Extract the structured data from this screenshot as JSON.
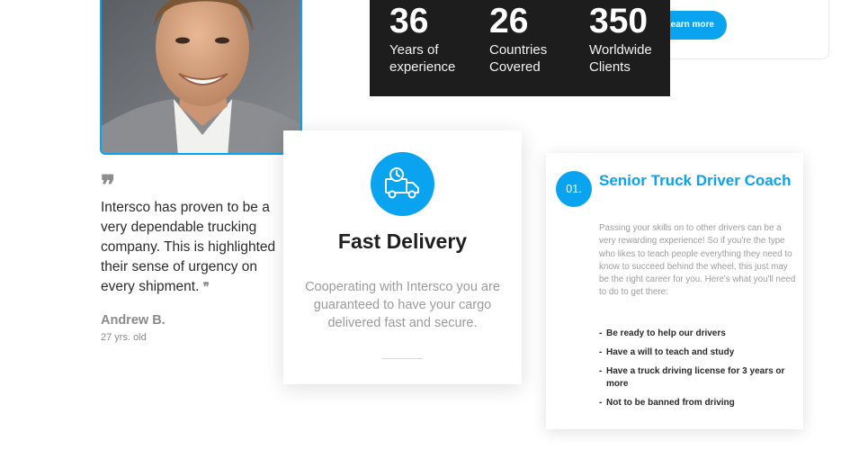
{
  "banner": {
    "button_label": "Learn more"
  },
  "stats": [
    {
      "number": "36",
      "label_line1": "Years of",
      "label_line2": "experience"
    },
    {
      "number": "26",
      "label_line1": "Countries",
      "label_line2": "Covered"
    },
    {
      "number": "350",
      "label_line1": "Worldwide",
      "label_line2": "Clients"
    }
  ],
  "testimonial": {
    "quote": "Intersco has proven to be a very dependable trucking company. This is highlighted their sense of urgency on every shipment.",
    "open_mark": "❞",
    "close_mark": "❞",
    "author": "Andrew B.",
    "age": "27 yrs. old"
  },
  "delivery": {
    "icon": "delivery-truck-icon",
    "title": "Fast Delivery",
    "text": "Cooperating with Intersco you are guaranteed to have your cargo delivered fast and secure."
  },
  "career": {
    "number": "01.",
    "title": "Senior Truck Driver Coach",
    "text": "Passing your skills on to other drivers can be a very rewarding experience! So if you're the type who likes to teach people everything they need to know to succeed behind the wheel, this just may be the right career for you. Here's what you'll need to do to get there:",
    "requirements": [
      "Be ready to help our drivers",
      "Have a will to teach and study",
      "Have a truck driving license for 3 years or more",
      "Not to be banned from driving"
    ]
  },
  "colors": {
    "accent": "#0aa3ef",
    "dark": "#1d1d1d"
  }
}
